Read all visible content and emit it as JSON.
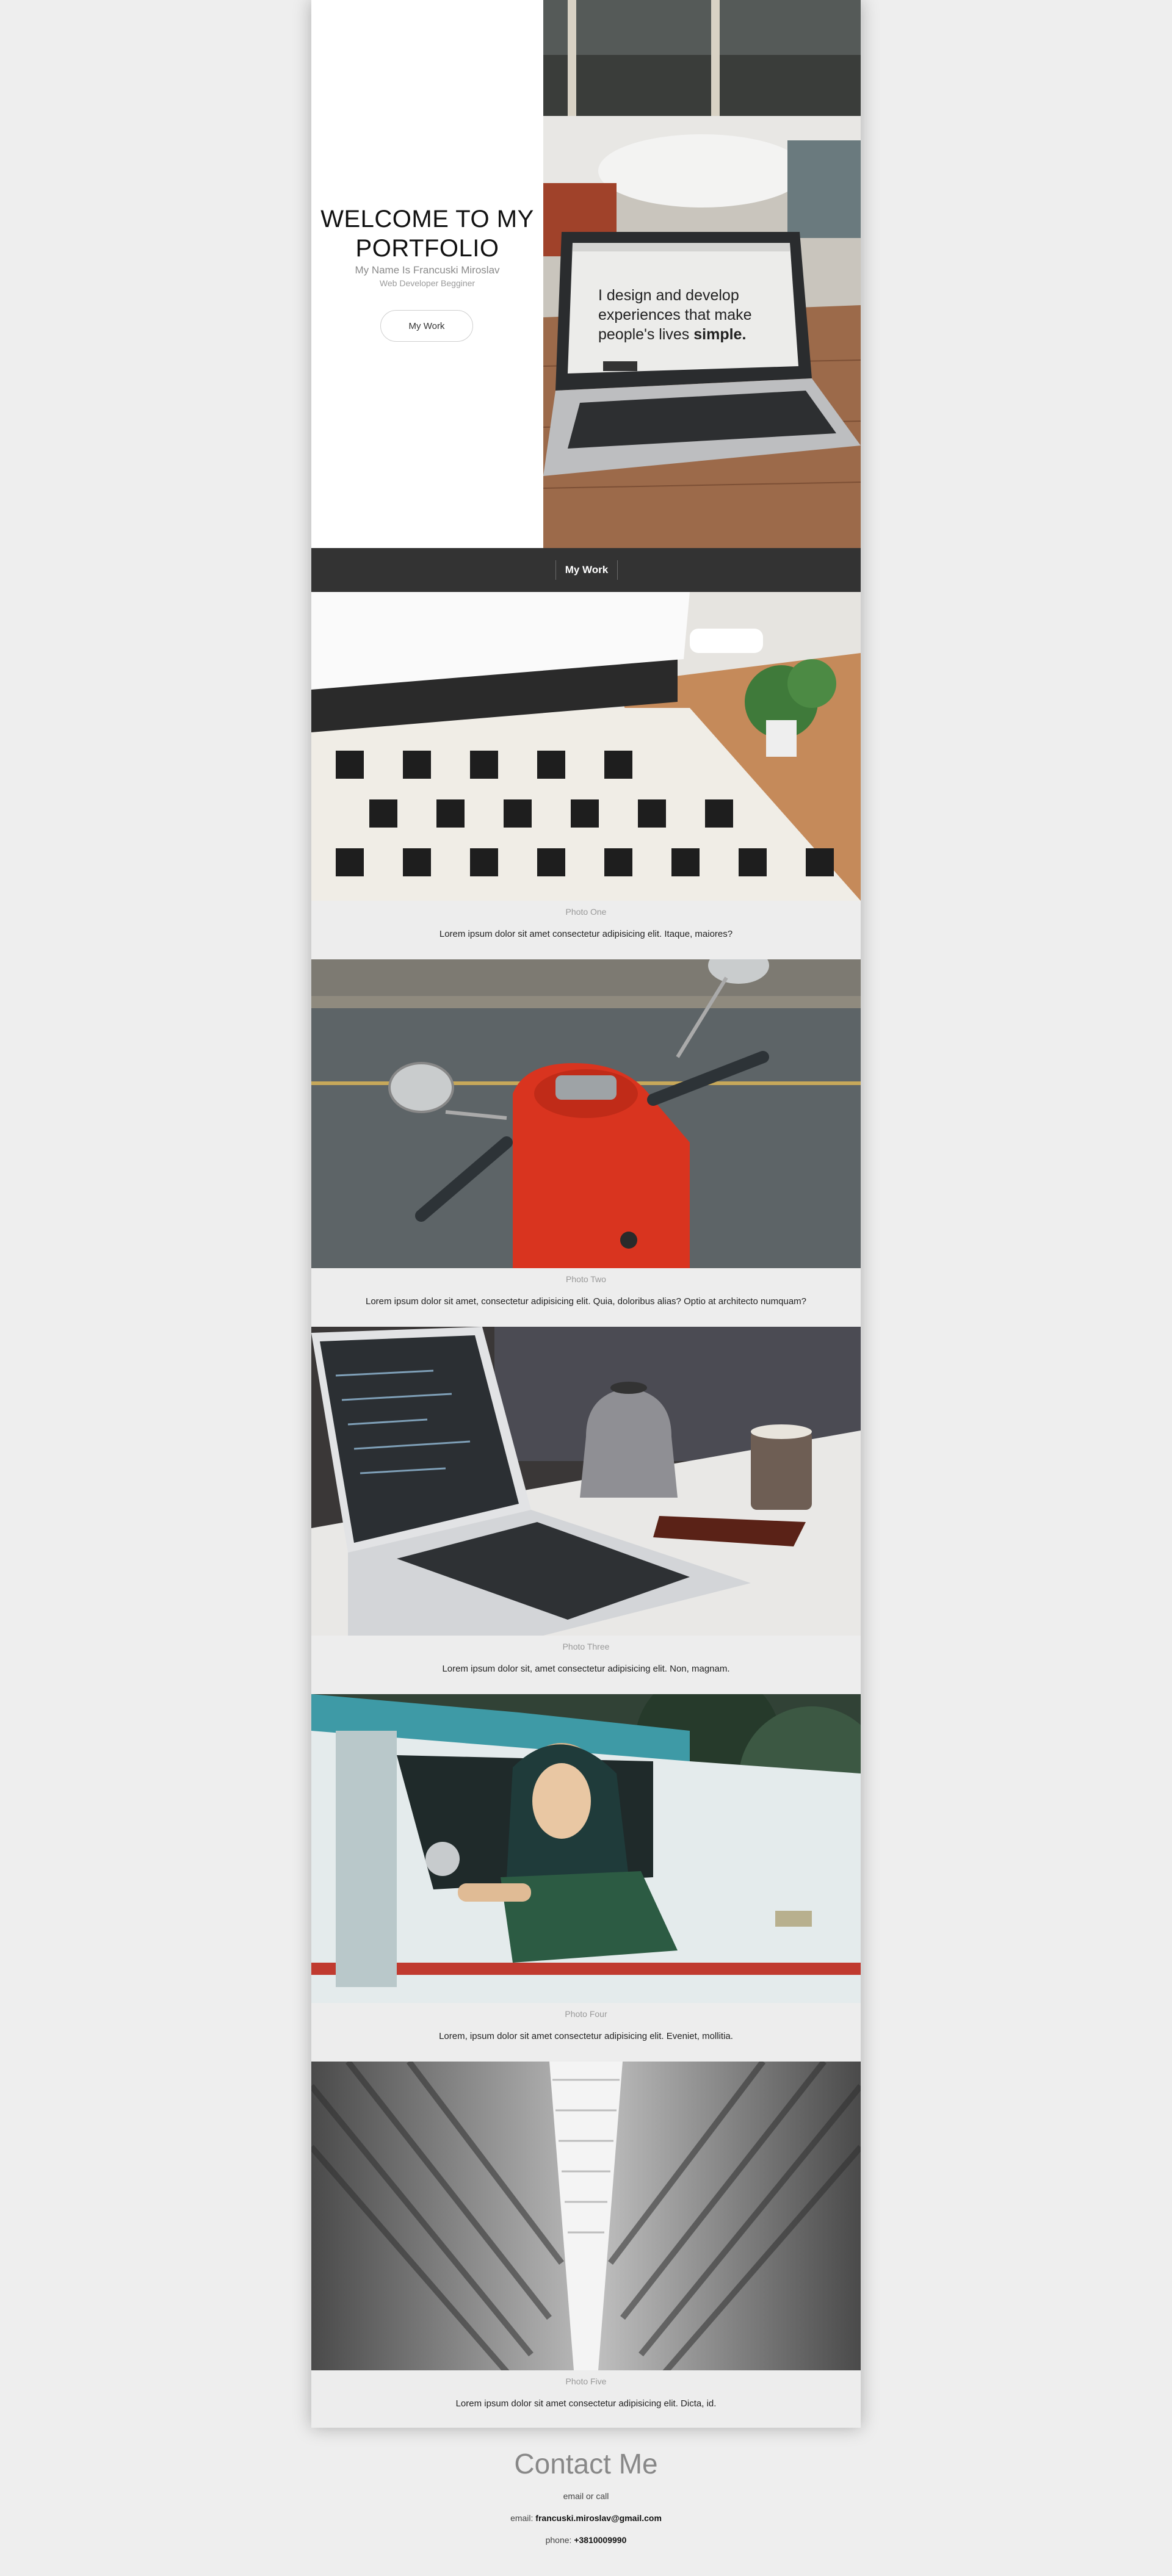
{
  "hero": {
    "title": "WELCOME TO MY PORTFOLIO",
    "name": "My Name Is Francuski Miroslav",
    "role": "Web Developer Begginer",
    "button_label": "My Work",
    "laptop_screen": {
      "line1": "I design and develop",
      "line2": "experiences that make",
      "line3": "people's lives ",
      "line3_bold": "simple."
    }
  },
  "nav": {
    "item": "My Work"
  },
  "work": [
    {
      "title": "Photo One",
      "desc": "Lorem ipsum dolor sit amet consectetur adipisicing elit. Itaque, maiores?",
      "image": "bedroom-rug-photo"
    },
    {
      "title": "Photo Two",
      "desc": "Lorem ipsum dolor sit amet, consectetur adipisicing elit. Quia, doloribus alias? Optio at architecto numquam?",
      "image": "red-scooter-photo"
    },
    {
      "title": "Photo Three",
      "desc": "Lorem ipsum dolor sit, amet consectetur adipisicing elit. Non, magnam.",
      "image": "laptop-kettle-photo"
    },
    {
      "title": "Photo Four",
      "desc": "Lorem, ipsum dolor sit amet consectetur adipisicing elit. Eveniet, mollitia.",
      "image": "woman-truck-photo"
    },
    {
      "title": "Photo Five",
      "desc": "Lorem ipsum dolor sit amet consectetur adipisicing elit. Dicta, id.",
      "image": "architecture-photo"
    }
  ],
  "contact": {
    "title": "Contact Me",
    "subtitle": "email or call",
    "email_label": "email: ",
    "email": "francuski.miroslav@gmail.com",
    "phone_label": "phone: ",
    "phone": "+3810009990"
  },
  "colors": {
    "page_bg": "#eeeeee",
    "nav_bg": "#333333",
    "scooter_red": "#d9341f",
    "truck_teal": "#3e9aa6"
  }
}
